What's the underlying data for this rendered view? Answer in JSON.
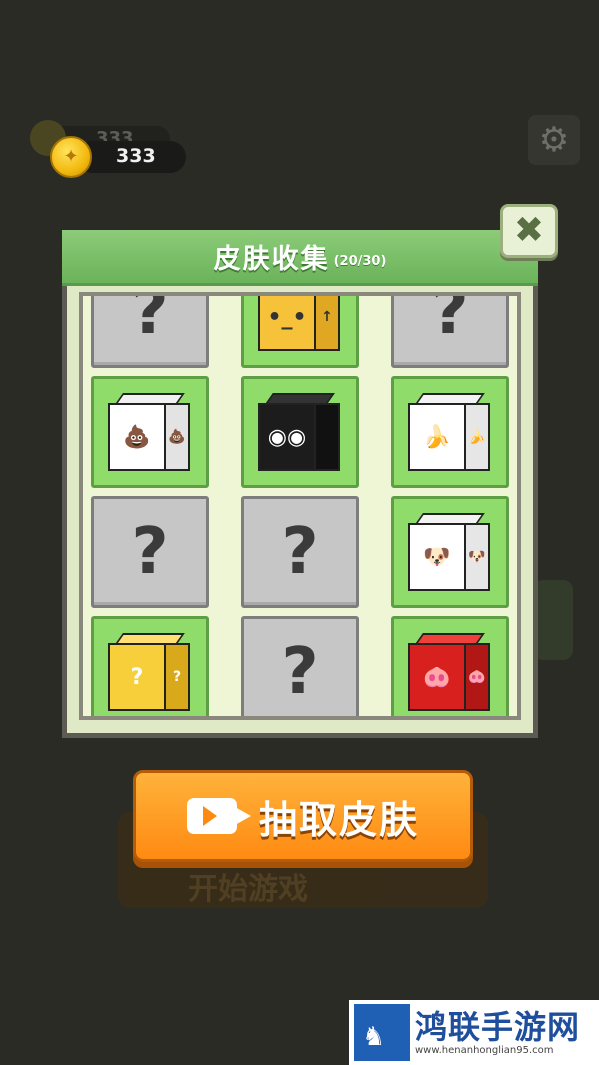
{
  "hud": {
    "coins": "333",
    "coins_bg": "333",
    "coin_symbol": "✦",
    "settings_icon": "⚙"
  },
  "modal": {
    "title": "皮肤收集",
    "count": "(20/30)",
    "close_icon": "✖"
  },
  "skins": [
    {
      "state": "locked",
      "label": "?"
    },
    {
      "state": "owned",
      "skin": "yellow-face-cube",
      "face": "•_•",
      "side": "↑"
    },
    {
      "state": "locked",
      "label": "?"
    },
    {
      "state": "owned",
      "skin": "poop-cube",
      "face": "💩",
      "side": "💩"
    },
    {
      "state": "owned",
      "skin": "panda-cube",
      "face": "◉◉",
      "side": ""
    },
    {
      "state": "owned",
      "skin": "banana-cube",
      "face": "🍌",
      "side": "🍌"
    },
    {
      "state": "locked",
      "label": "?"
    },
    {
      "state": "locked",
      "label": "?"
    },
    {
      "state": "owned",
      "skin": "dog-cube",
      "face": "🐶",
      "side": "🐶"
    },
    {
      "state": "owned",
      "skin": "question-block-cube",
      "face": "?",
      "side": "?"
    },
    {
      "state": "locked",
      "label": "?"
    },
    {
      "state": "owned",
      "skin": "pig-nose-cube",
      "face": "🐽",
      "side": "🐽"
    }
  ],
  "actions": {
    "draw_skin": "抽取皮肤",
    "background_button": "开始游戏"
  },
  "watermark": {
    "name": "鸿联手游网",
    "url": "www.henanhonglian95.com"
  },
  "colors": {
    "header_green": "#7fc06c",
    "owned_green": "#8fdc6a",
    "locked_gray": "#c6c6c6",
    "draw_orange": "#ff9a22"
  }
}
